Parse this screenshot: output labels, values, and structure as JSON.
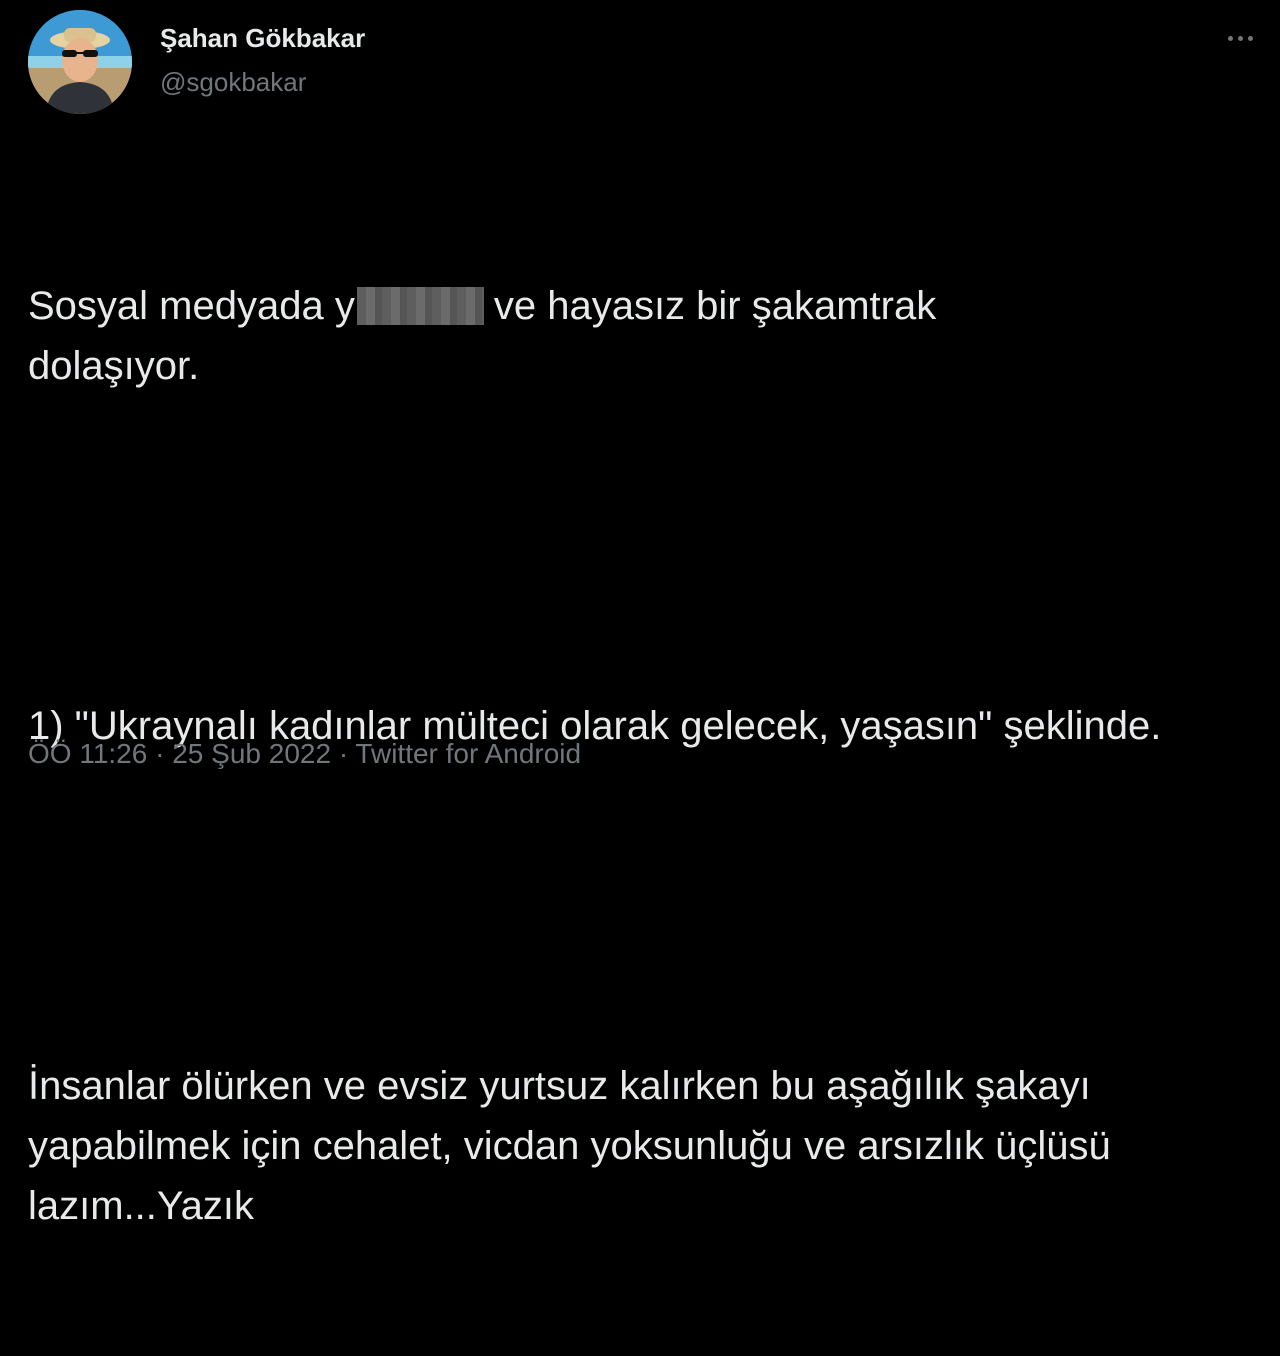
{
  "author": {
    "name": "Şahan Gökbakar",
    "handle": "@sgokbakar",
    "avatar_icon": "user-avatar"
  },
  "more_icon": "more-horizontal-icon",
  "tweet": {
    "line1_before": "Sosyal medyada y",
    "line1_after": "ve hayasız bir şakamtrak",
    "line2": "dolaşıyor.",
    "paragraph2": "1) \"Ukraynalı kadınlar mülteci olarak gelecek, yaşasın\" şeklinde.",
    "paragraph3": "İnsanlar ölürken ve evsiz yurtsuz kalırken bu aşağılık şakayı yapabilmek için cehalet, vicdan yoksunluğu ve arsızlık üçlüsü lazım...Yazık"
  },
  "meta": {
    "time": "ÖÖ 11:26",
    "separator": "·",
    "date": "25 Şub 2022",
    "source": "Twitter for Android"
  },
  "colors": {
    "background": "#000000",
    "text": "#e7e9ea",
    "secondary": "#71767b"
  }
}
